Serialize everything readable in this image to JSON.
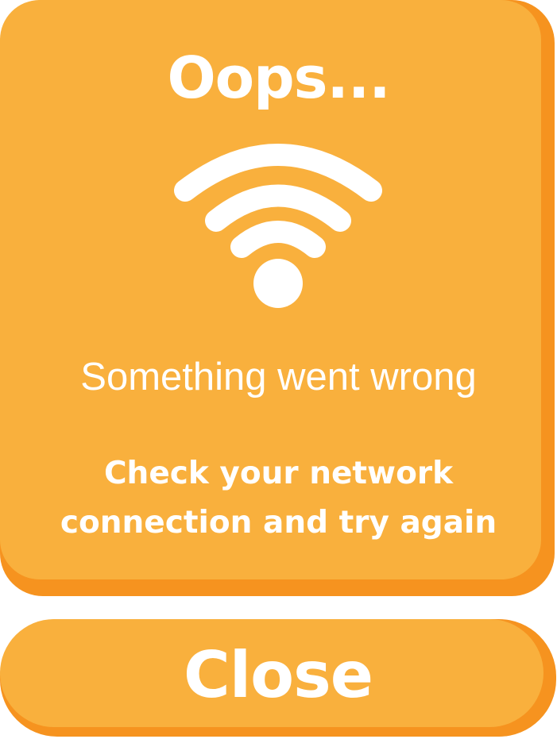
{
  "dialog": {
    "title": "Oops...",
    "icon": "wifi-icon",
    "subtitle": "Something went wrong",
    "message_lines": [
      "Check your network",
      "connection and try again"
    ]
  },
  "close_button": {
    "label": "Close"
  },
  "colors": {
    "card_face": "#f9b03d",
    "card_shadow": "#f6931f",
    "text": "#ffffff"
  }
}
